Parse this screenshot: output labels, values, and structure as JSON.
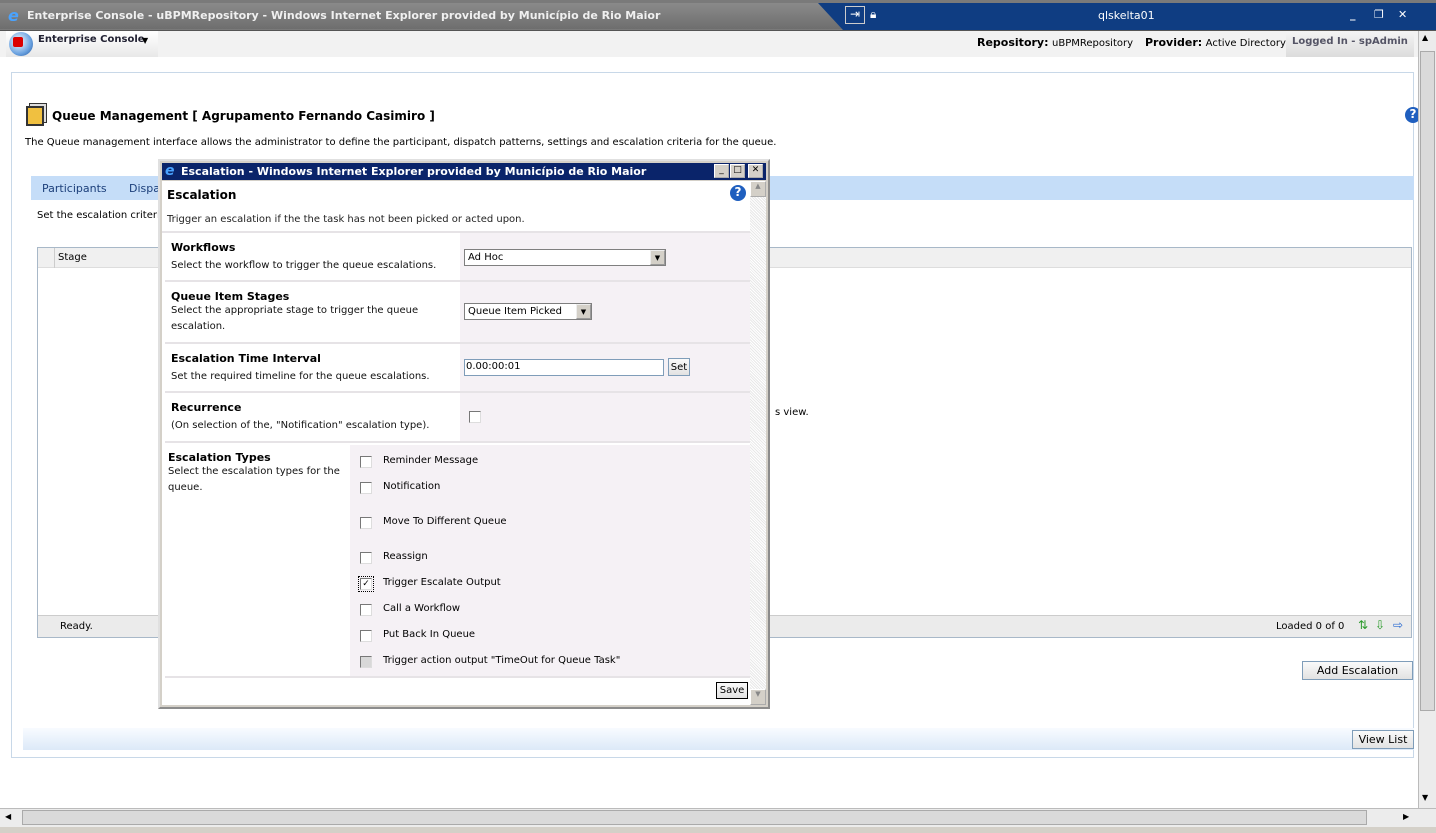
{
  "window": {
    "title": "Enterprise Console - uBPMRepository - Windows Internet Explorer provided by Município de Rio Maior",
    "host": "qlskelta01"
  },
  "toolbar": {
    "app_menu": "Enterprise Console",
    "repository_label": "Repository:",
    "repository_value": "uBPMRepository",
    "provider_label": "Provider:",
    "provider_value": "Active Directory",
    "logged_in": "Logged In - spAdmin"
  },
  "page": {
    "title": "Queue Management [ Agrupamento Fernando Casimiro ]",
    "description": "The Queue management interface allows the administrator to define the participant, dispatch patterns, settings and escalation criteria for the queue.",
    "tabs": [
      {
        "label": "Participants"
      },
      {
        "label": "Dispa"
      }
    ],
    "instructions": "Set the escalation criteri",
    "grid": {
      "columns": [
        "Stage"
      ],
      "hidden_text": "s view.",
      "status": "Ready.",
      "loaded": "Loaded 0 of 0"
    },
    "add_button": "Add Escalation",
    "view_list_button": "View List"
  },
  "dialog": {
    "title": "Escalation - Windows Internet Explorer provided by Município de Rio Maior",
    "heading": "Escalation",
    "subtitle": "Trigger an escalation if the the task has not been picked or acted upon.",
    "workflows": {
      "label": "Workflows",
      "desc": "Select the workflow to trigger the queue escalations.",
      "value": "Ad Hoc"
    },
    "stages": {
      "label": "Queue Item Stages",
      "desc": "Select the appropriate stage to trigger the queue escalation.",
      "value": "Queue Item Picked"
    },
    "interval": {
      "label": "Escalation Time Interval",
      "desc": "Set the required timeline for the queue escalations.",
      "value": "0.00:00:01",
      "set_button": "Set"
    },
    "recurrence": {
      "label": "Recurrence",
      "desc": "(On selection of the, \"Notification\" escalation type).",
      "checked": false
    },
    "types": {
      "label": "Escalation Types",
      "desc": "Select the escalation types for the queue.",
      "items": [
        {
          "label": "Reminder Message",
          "checked": false
        },
        {
          "label": "Notification",
          "checked": false
        },
        {
          "label": "Move To Different Queue",
          "checked": false
        },
        {
          "label": "Reassign",
          "checked": false
        },
        {
          "label": "Trigger Escalate Output",
          "checked": true
        },
        {
          "label": "Call a Workflow",
          "checked": false
        },
        {
          "label": "Put Back In Queue",
          "checked": false
        },
        {
          "label": "Trigger action output \"TimeOut for Queue Task\"",
          "checked": false,
          "disabled": true
        }
      ]
    },
    "save_button": "Save"
  }
}
